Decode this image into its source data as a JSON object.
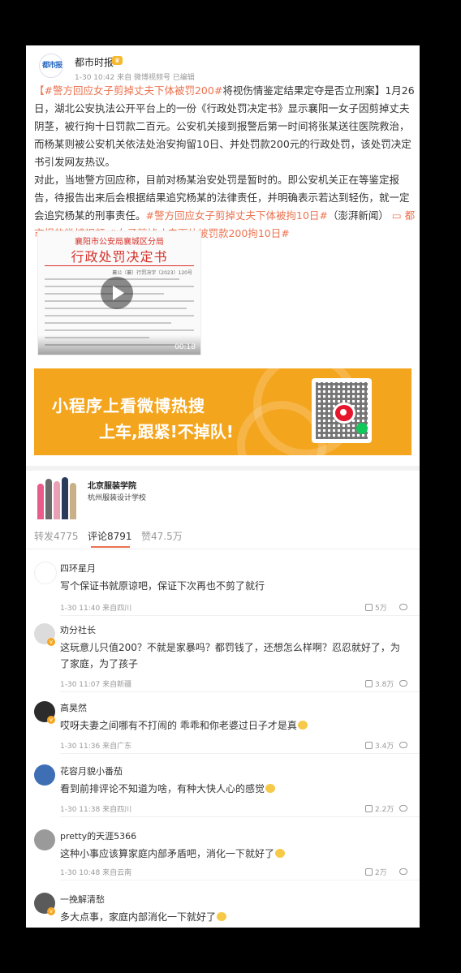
{
  "post": {
    "author": "都市时报",
    "avatar_text": "都市报",
    "crown_icon": "crown-icon",
    "meta": "1-30 10:42 来自 微博视频号 已编辑",
    "p1_tag1": "【#警方回应女子剪掉丈夫下体被罚200#",
    "p1_rest": "将视伤情鉴定结果定夺是否立刑案】1月26日，湖北公安执法公开平台上的一份《行政处罚决定书》显示襄阳一女子因剪掉丈夫阴茎，被行拘十日罚款二百元。公安机关接到报警后第一时间将张某送往医院救治，而杨某则被公安机关依法处治安拘留10日、并处罚款200元的行政处罚，该处罚决定书引发网友热议。",
    "p2_text": "对此，当地警方回应称，目前对杨某治安处罚是暂时的。即公安机关正在等鉴定报告，待报告出来后会根据结果追究杨某的法律责任，并明确表示若达到轻伤，就一定会追究杨某的刑事责任。",
    "p2_tag2": "#警方回应女子剪掉丈夫下体被拘10日#",
    "p2_source": "（澎湃新闻）",
    "p2_link": "都市报的微博视频",
    "p2_tag3": "#女子剪掉丈夫下体被罚款200拘10日#",
    "doc_header": "襄阳市公安局襄城区分局",
    "doc_title": "行政处罚决定书",
    "doc_number": "襄公（襄）行罚决字〔2023〕120号",
    "video_time": "00:18",
    "banner_line1": "小程序上看微博热搜",
    "banner_line2": "上车,跟紧!不掉队!"
  },
  "ad": {
    "title": "北京服装学院",
    "subtitle": "杭州服装设计学校"
  },
  "tabs": {
    "repost": "转发4775",
    "comments": "评论8791",
    "likes": "赞47.5万"
  },
  "comments": [
    {
      "name": "四环星月",
      "text": "写个保证书就原谅吧，保证下次再也不剪了就行",
      "meta": "1-30 11:40 来自四川",
      "likes": "5万"
    },
    {
      "name": "劝分社长",
      "text": "这玩意儿只值200？不就是家暴吗？都罚钱了，还想怎么样啊？忍忍就好了，为了家庭，为了孩子",
      "meta": "1-30 11:07 来自新疆",
      "likes": "3.8万"
    },
    {
      "name": "高昊然",
      "text": "哎呀夫妻之间哪有不打闹的 乖乖和你老婆过日子才是真",
      "meta": "1-30 11:36 来自广东",
      "likes": "3.4万"
    },
    {
      "name": "花容月貌小番茄",
      "text": "看到前排评论不知道为啥，有种大快人心的感觉",
      "meta": "1-30 11:38 来自四川",
      "likes": "2.2万"
    },
    {
      "name": "pretty的天涯5366",
      "text": "这种小事应该算家庭内部矛盾吧，消化一下就好了",
      "meta": "1-30 10:48 来自云南",
      "likes": "2万"
    },
    {
      "name": "一挽解清愁",
      "text": "多大点事，家庭内部消化一下就好了",
      "meta": "",
      "likes": ""
    }
  ],
  "colors": {
    "accent": "#eb7350",
    "banner": "#f4a51e"
  }
}
